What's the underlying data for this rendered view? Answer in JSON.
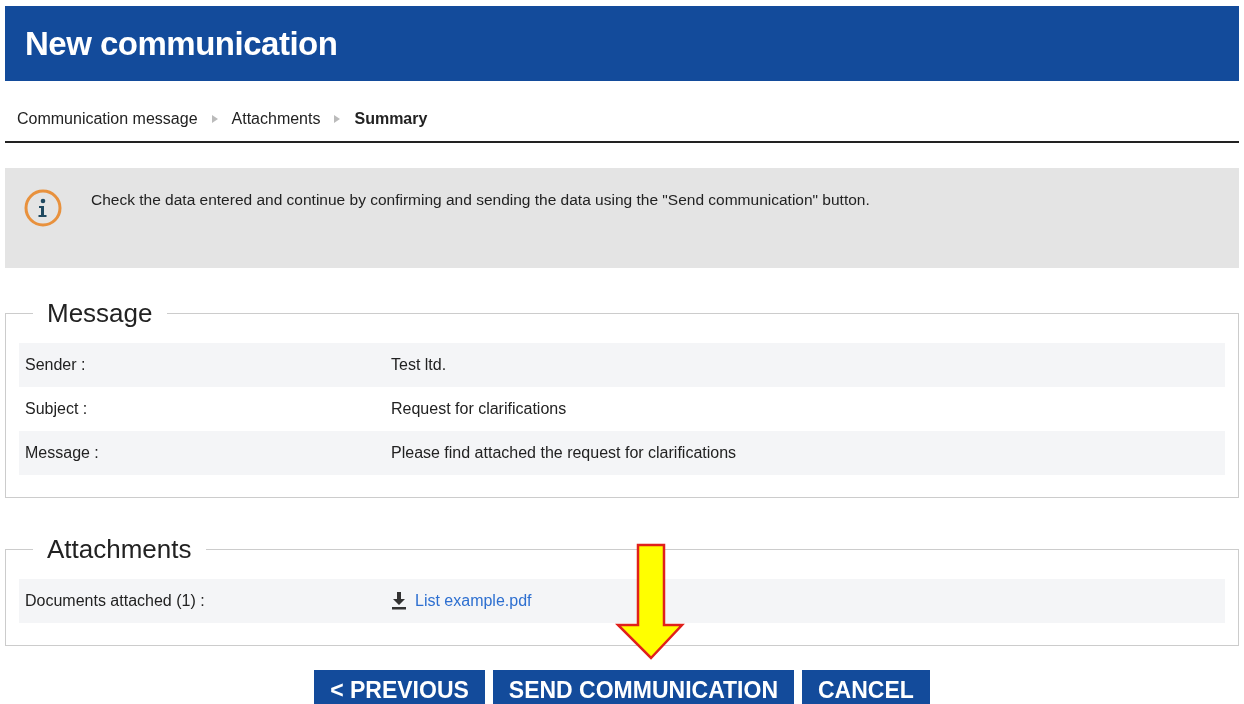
{
  "header": {
    "title": "New communication"
  },
  "steps": [
    {
      "label": "Communication message",
      "selected": false
    },
    {
      "label": "Attachments",
      "selected": false
    },
    {
      "label": "Summary",
      "selected": true
    }
  ],
  "info": {
    "text": "Check the data entered and continue by confirming and sending the data using the \"Send communication\" button."
  },
  "sections": [
    {
      "title": "Message",
      "rows": [
        {
          "label": "Sender :",
          "value": "Test ltd.",
          "kind": "text"
        },
        {
          "label": "Subject :",
          "value": "Request for clarifications",
          "kind": "text"
        },
        {
          "label": "Message :",
          "value": "Please find attached the request for clarifications",
          "kind": "text"
        }
      ]
    },
    {
      "title": "Attachments",
      "rows": [
        {
          "label": "Documents attached (1) :",
          "value": "List example.pdf",
          "kind": "file"
        }
      ]
    }
  ],
  "buttons": [
    "< PREVIOUS",
    "SEND COMMUNICATION",
    "CANCEL"
  ]
}
